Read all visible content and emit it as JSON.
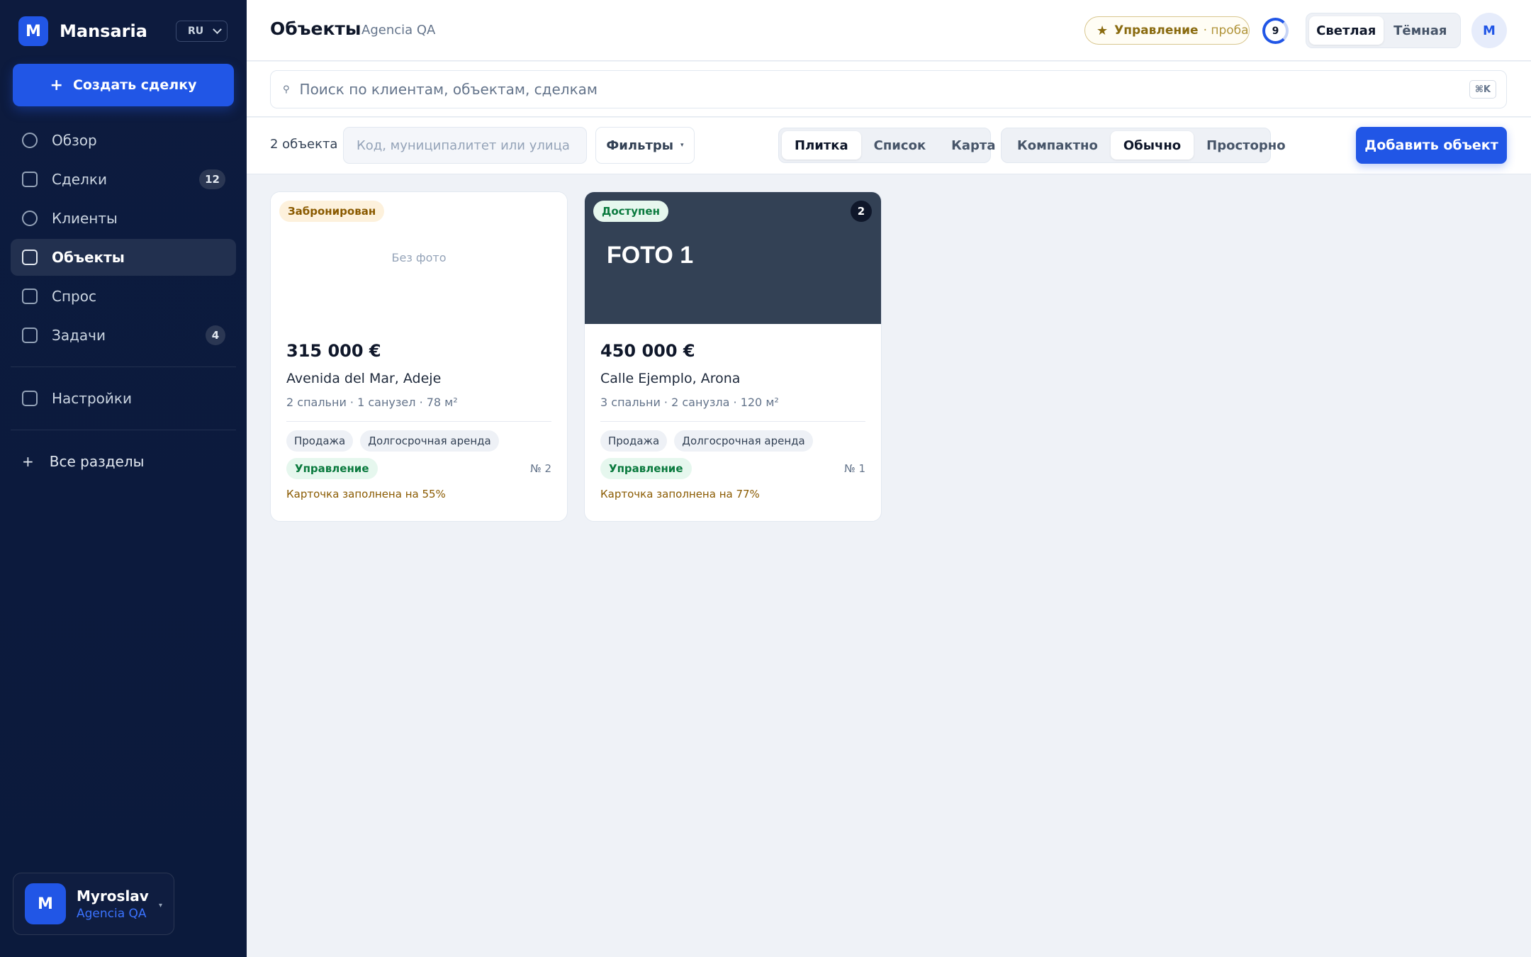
{
  "app": {
    "logo_letter": "M",
    "name": "Mansaria",
    "language": "RU"
  },
  "sidebar": {
    "create_label": "Создать сделку",
    "items": [
      {
        "label": "Обзор",
        "badge": ""
      },
      {
        "label": "Сделки",
        "badge": "12"
      },
      {
        "label": "Клиенты",
        "badge": ""
      },
      {
        "label": "Объекты",
        "badge": ""
      },
      {
        "label": "Спрос",
        "badge": ""
      },
      {
        "label": "Задачи",
        "badge": "4"
      },
      {
        "label": "Настройки",
        "badge": ""
      }
    ],
    "all_sections_label": "Все разделы",
    "user": {
      "initial": "M",
      "name": "Myroslav",
      "org": "Agencia QA"
    }
  },
  "header": {
    "title": "Объекты",
    "subtitle": "Agencia QA",
    "plan_name": "Управление",
    "plan_trial": "· проба",
    "ring_count": "9",
    "theme_light": "Светлая",
    "theme_dark": "Тёмная",
    "avatar_initial": "M"
  },
  "search": {
    "placeholder": "Поиск по клиентам, объектам, сделкам",
    "shortcut": "⌘K"
  },
  "toolbar": {
    "count": "2 объекта",
    "filter_placeholder": "Код, муниципалитет или улица",
    "filters_label": "Фильтры",
    "views": [
      "Плитка",
      "Список",
      "Карта"
    ],
    "densities": [
      "Компактно",
      "Обычно",
      "Просторно"
    ],
    "add_label": "Добавить объект"
  },
  "listings": [
    {
      "status": "Забронирован",
      "photo_text": "Без фото",
      "price": "315 000 €",
      "address": "Avenida del Mar, Adeje",
      "specs": "2 спальни · 1 санузел · 78 м²",
      "tags": [
        "Продажа",
        "Долгосрочная аренда"
      ],
      "management": "Управление",
      "number": "№ 2",
      "completion": "Карточка заполнена на 55%"
    },
    {
      "status": "Доступен",
      "photo_text": "FOTO 1",
      "photo_count": "2",
      "price": "450 000 €",
      "address": "Calle Ejemplo, Arona",
      "specs": "3 спальни · 2 санузла · 120 м²",
      "tags": [
        "Продажа",
        "Долгосрочная аренда"
      ],
      "management": "Управление",
      "number": "№ 1",
      "completion": "Карточка заполнена на 77%"
    }
  ],
  "colors": {
    "sidebar_bg": "#0d1b3e",
    "accent": "#2156e6",
    "status_reserved": "#8a5a00",
    "status_available": "#0a7a3e",
    "page_bg": "#eff2f7"
  }
}
